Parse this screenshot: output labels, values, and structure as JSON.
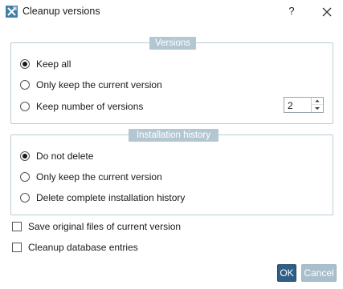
{
  "window": {
    "title": "Cleanup versions",
    "help_label": "?",
    "icons": {
      "app": "broom-cleanup-icon",
      "close": "close-icon"
    }
  },
  "versions": {
    "legend": "Versions",
    "options": [
      {
        "label": "Keep all",
        "selected": true
      },
      {
        "label": "Only keep the current version",
        "selected": false
      },
      {
        "label": "Keep number of versions",
        "selected": false
      }
    ],
    "count_value": "2"
  },
  "installation_history": {
    "legend": "Installation history",
    "options": [
      {
        "label": "Do not delete",
        "selected": true
      },
      {
        "label": "Only keep the current version",
        "selected": false
      },
      {
        "label": "Delete complete installation history",
        "selected": false
      }
    ]
  },
  "checkboxes": [
    {
      "label": "Save original files of current version",
      "checked": false
    },
    {
      "label": "Cleanup database entries",
      "checked": false
    }
  ],
  "buttons": {
    "ok": "OK",
    "cancel": "Cancel"
  },
  "colors": {
    "legend_bg": "#b3c7d3",
    "group_border": "#b9ccd6",
    "ok_bg": "#2f5f86",
    "cancel_bg": "#a9bfcd"
  }
}
